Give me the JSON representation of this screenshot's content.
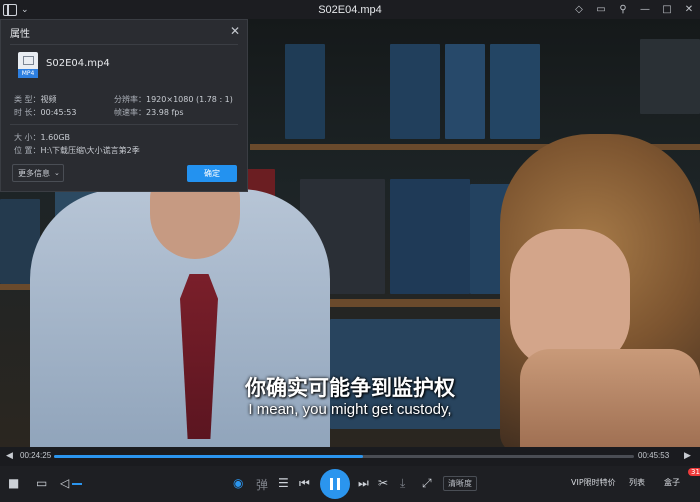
{
  "window": {
    "title": "S02E04.mp4"
  },
  "video": {
    "subtitle_cn": "你确实可能争到监护权",
    "subtitle_en": "I mean, you might get custody,"
  },
  "dialog": {
    "title": "属性",
    "file_badge": "MP4",
    "filename": "S02E04.mp4",
    "type_label": "类 型：",
    "type_value": "视频",
    "resolution_label": "分辨率：",
    "resolution_value": "1920×1080 (1.78 : 1)",
    "duration_label": "时 长：",
    "duration_value": "00:45:53",
    "framerate_label": "帧速率：",
    "framerate_value": "23.98 fps",
    "size_label": "大 小：",
    "size_value": "1.60GB",
    "location_label": "位 置：",
    "location_value": "H:\\下载压缩\\大小谎言第2季",
    "more_button": "更多信息",
    "ok_button": "确定"
  },
  "progress": {
    "current_time": "00:24:25",
    "total_time": "00:45:53",
    "fraction": 0.532
  },
  "controls": {
    "quality_chip": "清晰度",
    "vip_link": "VIP限时特价",
    "playlist_label": "列表",
    "box_label": "盒子",
    "box_badge": "31"
  },
  "colors": {
    "accent": "#2b95ee",
    "badge": "#ee3b3b"
  }
}
